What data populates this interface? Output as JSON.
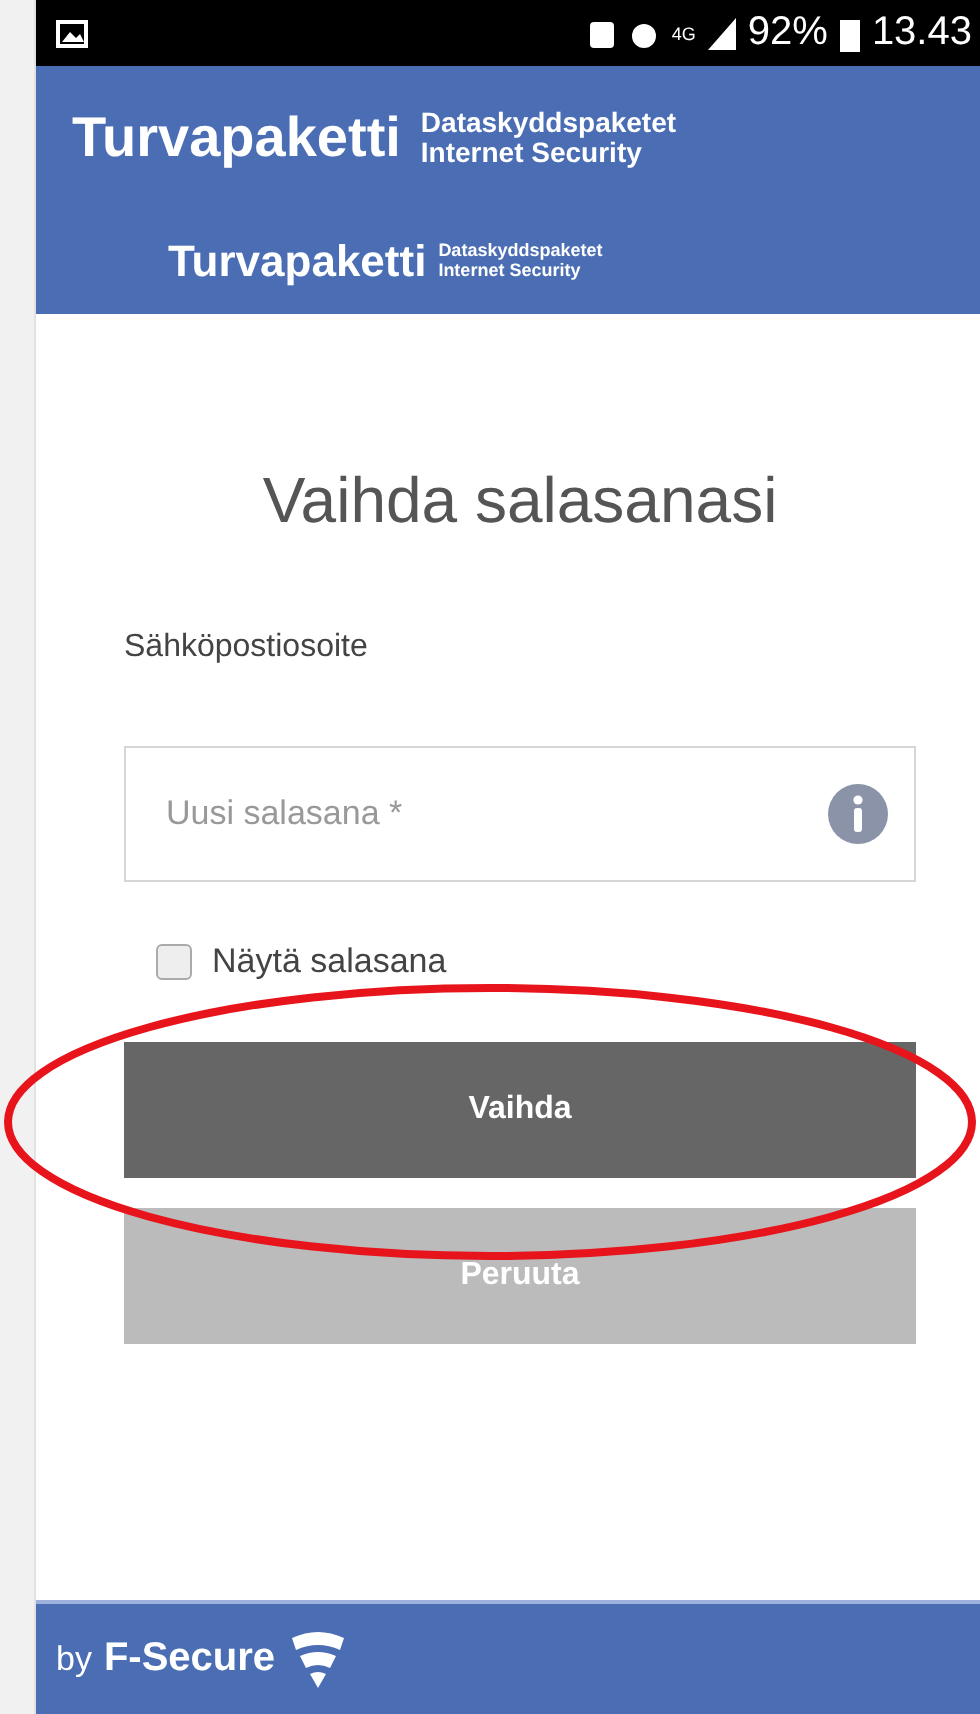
{
  "status_bar": {
    "network": "4G",
    "battery": "92%",
    "time": "13.43"
  },
  "header": {
    "logos": [
      {
        "name": "Turvapaketti",
        "lines": [
          "Dataskyddspaketet",
          "Internet Security"
        ]
      },
      {
        "name": "Turvapaketti",
        "lines": [
          "Dataskyddspaketet",
          "Internet Security"
        ]
      }
    ]
  },
  "form": {
    "title": "Vaihda salasanasi",
    "email_label": "Sähköpostiosoite",
    "password": {
      "placeholder": "Uusi salasana *"
    },
    "show_password": {
      "label": "Näytä salasana",
      "checked": false
    },
    "buttons": [
      {
        "label": "Vaihda",
        "kind": "primary"
      },
      {
        "label": "Peruuta",
        "kind": "secondary"
      }
    ]
  },
  "annotation": {
    "kind": "ellipse",
    "color": "#e8141b"
  },
  "footer": {
    "by": "by",
    "brand": "F-Secure"
  }
}
